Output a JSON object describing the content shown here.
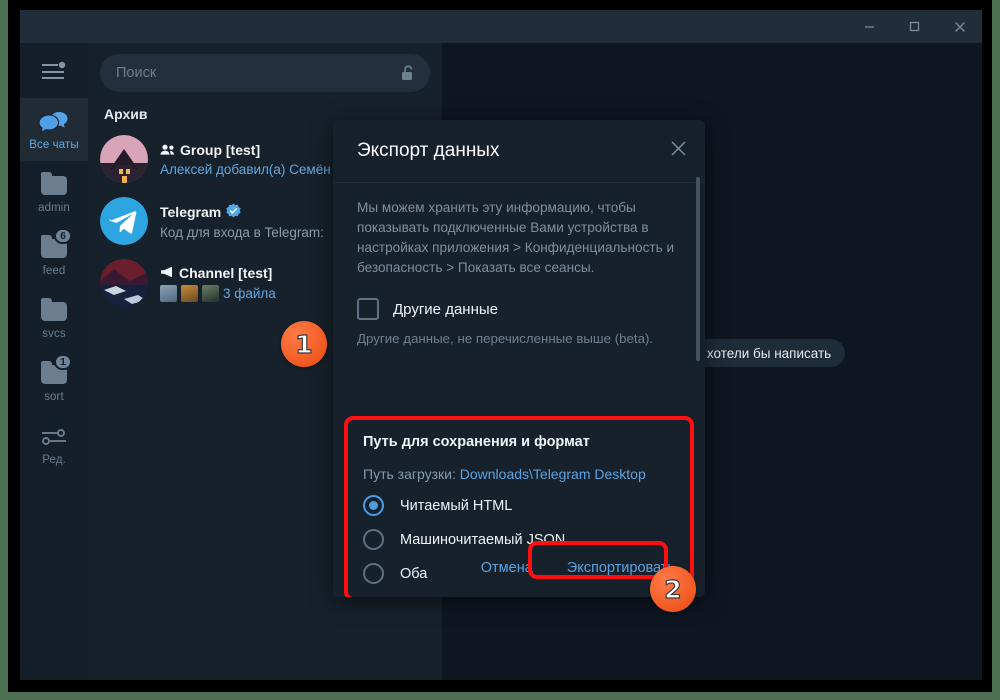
{
  "window": {
    "controls": [
      {
        "name": "minimize",
        "glyph": "minimize-icon"
      },
      {
        "name": "maximize",
        "glyph": "maximize-icon"
      },
      {
        "name": "close",
        "glyph": "close-icon"
      }
    ]
  },
  "sidebar": {
    "menu_icon": "hamburger-settings-icon",
    "items": [
      {
        "label": "Все чаты",
        "icon": "chats-icon",
        "badge": "",
        "active": true
      },
      {
        "label": "admin",
        "icon": "folder-icon",
        "badge": "",
        "active": false
      },
      {
        "label": "feed",
        "icon": "folder-icon",
        "badge": "6",
        "active": false
      },
      {
        "label": "svcs",
        "icon": "folder-icon",
        "badge": "",
        "active": false
      },
      {
        "label": "sort",
        "icon": "folder-icon",
        "badge": "1",
        "active": false
      },
      {
        "label": "Ред.",
        "icon": "sliders-icon",
        "badge": "",
        "active": false
      }
    ]
  },
  "search": {
    "placeholder": "Поиск",
    "lock_icon": "unlock-icon"
  },
  "chatlist": {
    "section_title": "Архив",
    "rows": [
      {
        "title": "Group [test]",
        "prefix_icon": "group-icon",
        "verified": false,
        "subtitle": "Алексей добавил(а) Семён",
        "subtitle_style": "blue",
        "avatar": "house-photo-avatar"
      },
      {
        "title": "Telegram",
        "prefix_icon": "",
        "verified": true,
        "subtitle": "Код для входа в Telegram:",
        "subtitle_style": "grey",
        "avatar": "telegram-logo-avatar"
      },
      {
        "title": "Channel [test]",
        "prefix_icon": "megaphone-icon",
        "verified": false,
        "subtitle": "3 файла",
        "subtitle_style": "blue",
        "avatar": "landscape-photo-avatar",
        "thumbnails": [
          "thumb-bird",
          "thumb-sunflower",
          "thumb-forest"
        ]
      }
    ]
  },
  "rightpane": {
    "pill_text": "му хотели бы написать"
  },
  "dialog": {
    "title": "Экспорт данных",
    "close_icon": "close-icon",
    "paragraph": "Мы можем хранить эту информацию, чтобы показывать подключенные Вами устройства в настройках приложения > Конфиденциальность и безопасность > Показать все сеансы.",
    "checkbox": {
      "label": "Другие данные",
      "checked": false,
      "hint": "Другие данные, не перечисленные выше (beta)."
    },
    "path_group": {
      "title": "Путь для сохранения и формат",
      "path_label": "Путь загрузки:",
      "path_value": "Downloads\\Telegram Desktop",
      "options": [
        {
          "label": "Читаемый HTML",
          "selected": true
        },
        {
          "label": "Машиночитаемый JSON",
          "selected": false
        },
        {
          "label": "Оба",
          "selected": false
        }
      ]
    },
    "cancel_label": "Отмена",
    "export_label": "Экспортировать"
  },
  "annotations": {
    "marker1": "1",
    "marker2": "2",
    "highlight_color": "#ff1010"
  }
}
